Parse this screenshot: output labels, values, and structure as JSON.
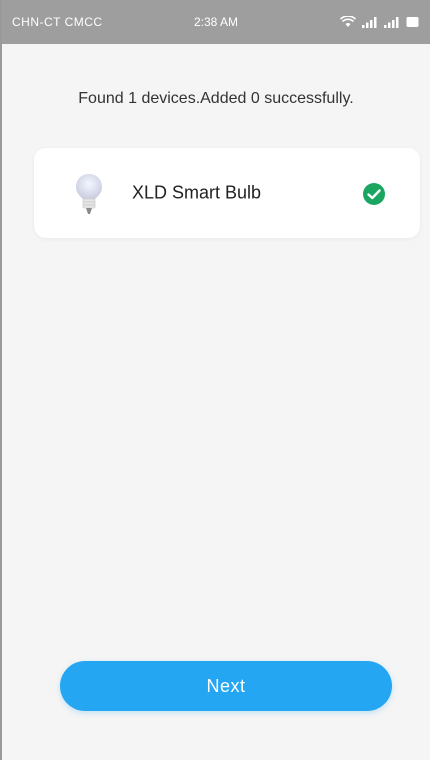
{
  "status_bar": {
    "carrier": "CHN-CT CMCC",
    "time": "2:38 AM",
    "icons": [
      "wifi-icon",
      "signal-icon",
      "signal-icon",
      "battery-icon"
    ]
  },
  "found_message": "Found 1 devices.Added 0 successfully.",
  "devices": [
    {
      "name": "XLD Smart Bulb",
      "icon": "bulb-icon",
      "status_icon": "check-circle-icon",
      "status_color": "#1aa661"
    }
  ],
  "next_button": {
    "label": "Next",
    "color": "#25a6f3"
  }
}
